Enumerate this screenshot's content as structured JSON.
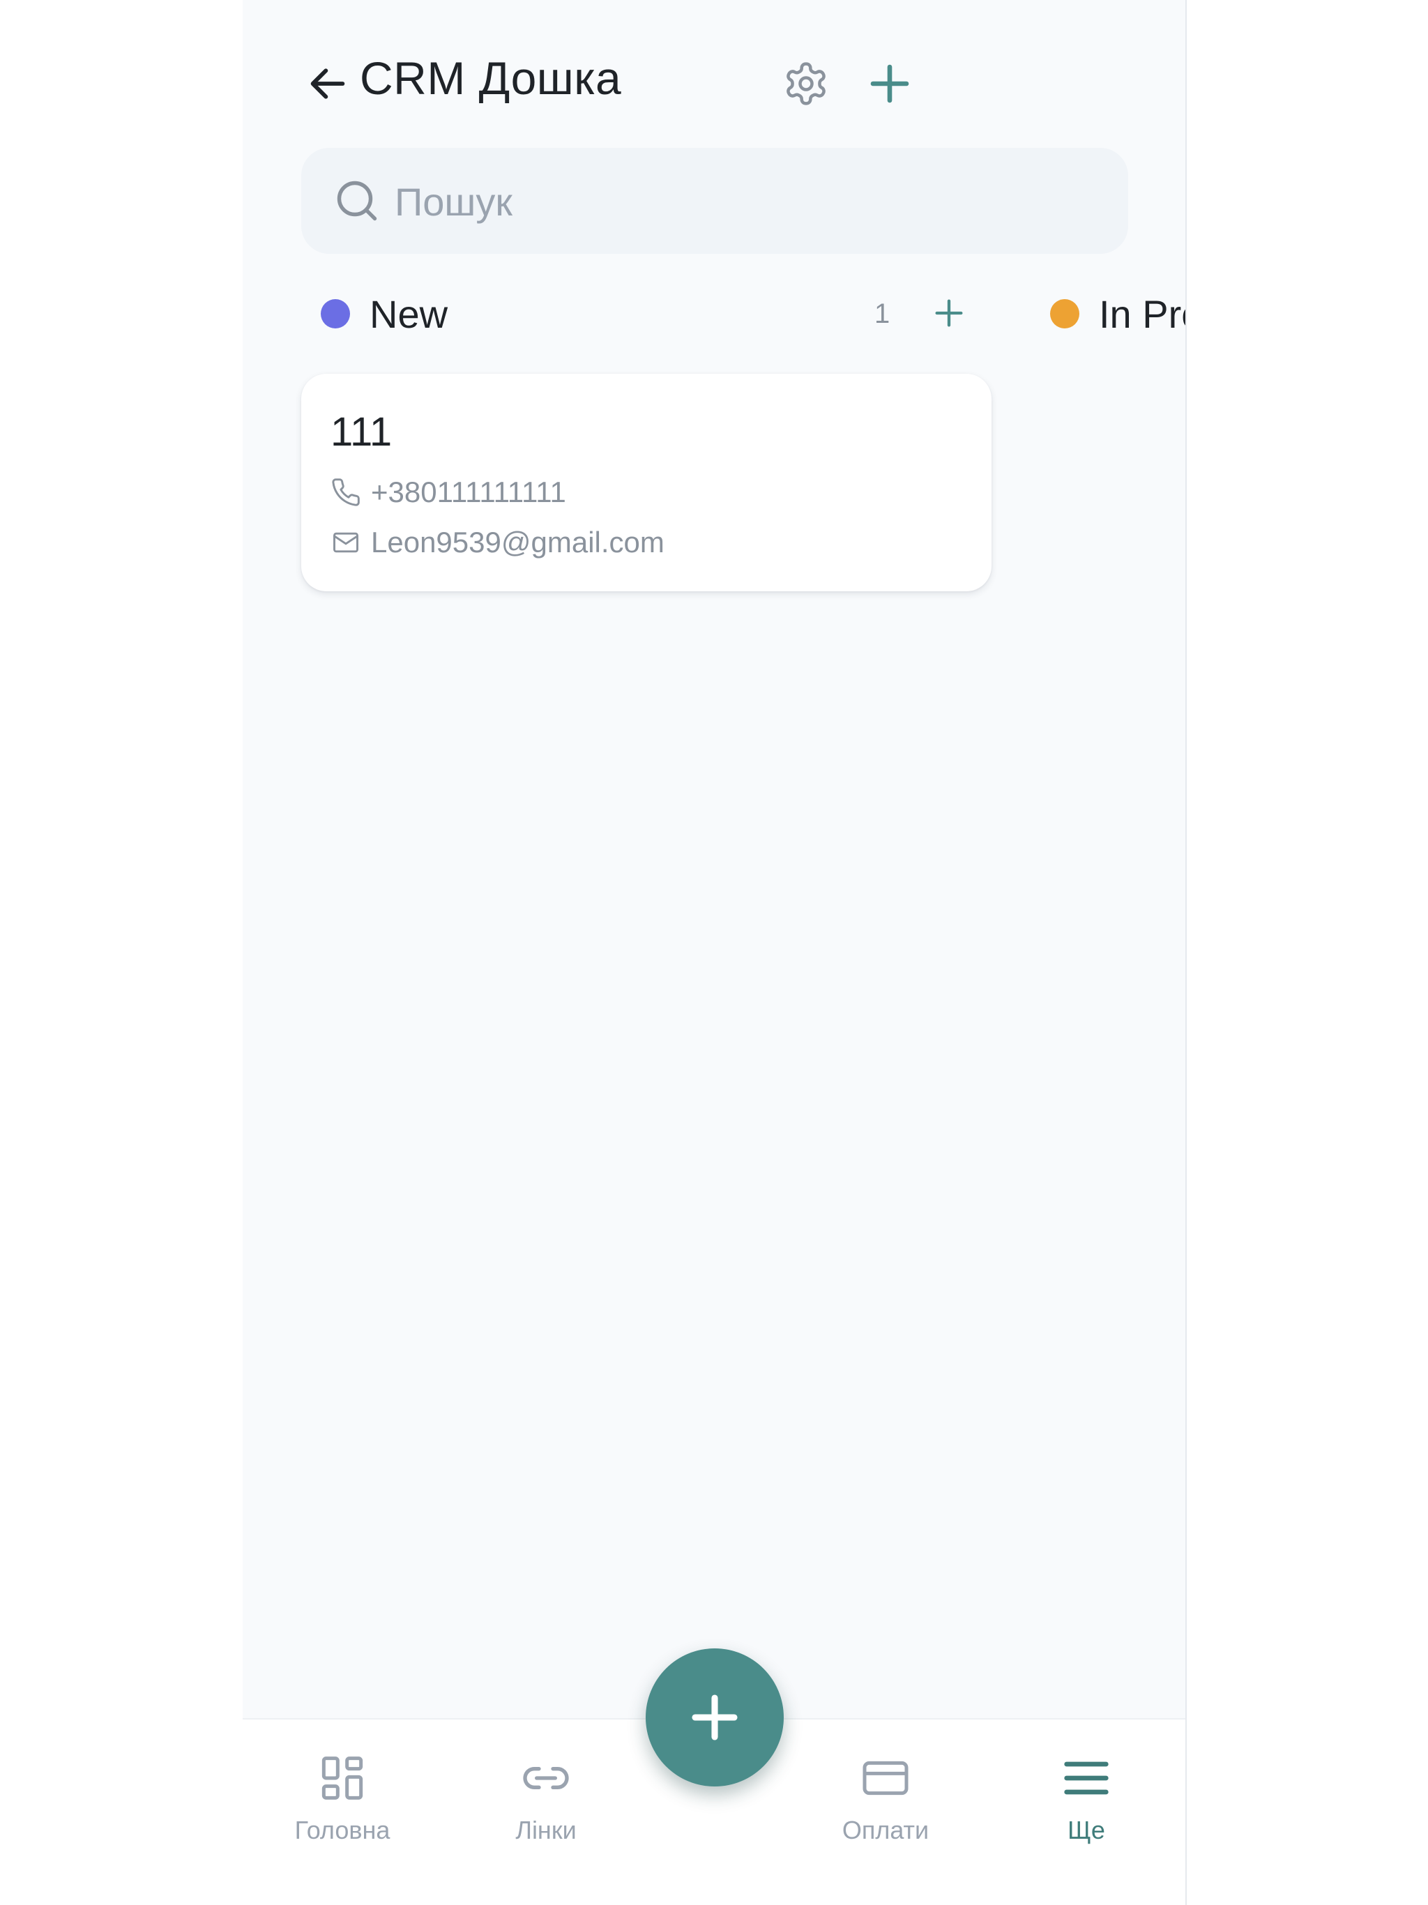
{
  "header": {
    "title": "CRM Дошка"
  },
  "search": {
    "placeholder": "Пошук"
  },
  "columns": [
    {
      "label": "New",
      "count": "1",
      "color": "#6b6ee4"
    },
    {
      "label": "In Pro",
      "color": "#eda233"
    }
  ],
  "card": {
    "name": "111",
    "phone": "+380111111111",
    "email": "Leon9539@gmail.com"
  },
  "bottom_nav": [
    {
      "label": "Головна",
      "icon": "grid-icon"
    },
    {
      "label": "Лінки",
      "icon": "link-icon"
    },
    {
      "label": "Оплати",
      "icon": "card-icon"
    },
    {
      "label": "Ще",
      "icon": "menu-icon",
      "active": true
    }
  ],
  "colors": {
    "accent": "#4a8c8a",
    "background": "#f8fafc"
  }
}
